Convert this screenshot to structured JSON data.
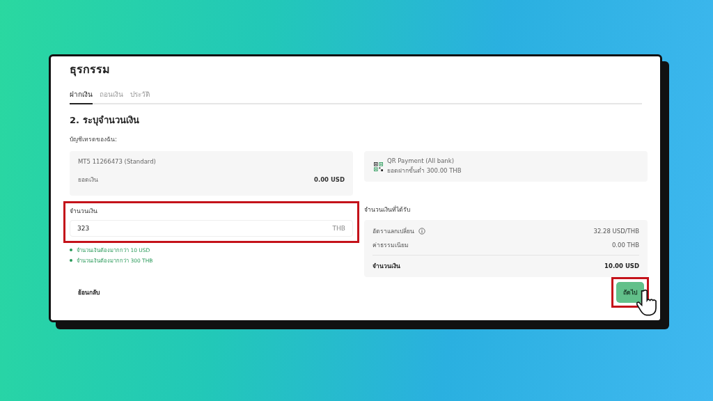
{
  "page": {
    "title": "ธุรกรรม"
  },
  "tabs": [
    {
      "label": "ฝากเงิน",
      "selected": true
    },
    {
      "label": "ถอนเงิน",
      "selected": false
    },
    {
      "label": "ประวัติ",
      "selected": false
    }
  ],
  "step_title": "2. ระบุจำนวนเงิน",
  "account_label": "บัญชีเทรดของฉัน:",
  "account": {
    "name": "MT5 11266473 (Standard)",
    "balance_label": "ยอดเงิน",
    "balance": "0.00 USD"
  },
  "payment": {
    "name": "QR Payment (All bank)",
    "minimum": "ยอดฝากขั้นต่ำ 300.00 THB"
  },
  "amount_field": {
    "label": "จำนวนเงิน",
    "value": "323",
    "currency": "THB",
    "highlighted": true
  },
  "hints": [
    "จำนวนเงินต้องมากกว่า 10 USD",
    "จำนวนเงินต้องมากกว่า 300 THB"
  ],
  "received": {
    "title": "จำนวนเงินที่ได้รับ",
    "rows": [
      {
        "label": "อัตราแลกเปลี่ยน",
        "value": "32.28 USD/THB",
        "info": true,
        "kind": "plain"
      },
      {
        "label": "ค่าธรรมเนียม",
        "value": "0.00 THB",
        "info": false,
        "kind": "plain"
      },
      {
        "label": "จำนวนเงิน",
        "value": "10.00 USD",
        "info": false,
        "kind": "total"
      }
    ]
  },
  "back_button": "ย้อนกลับ",
  "next_button": {
    "label": "ถัดไป",
    "highlighted": true
  }
}
